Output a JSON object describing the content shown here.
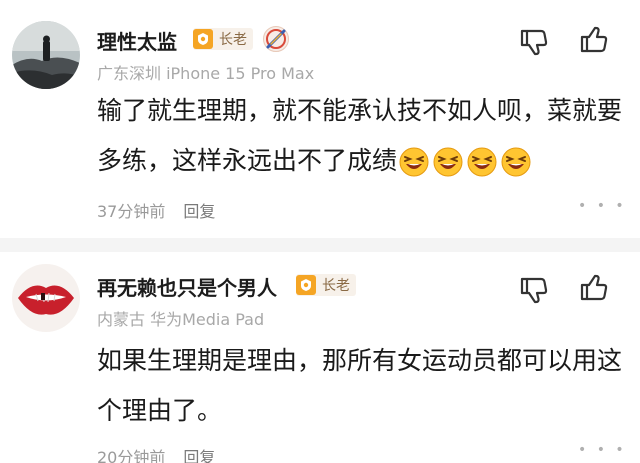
{
  "comments": [
    {
      "username": "理性太监",
      "badge": "长老",
      "location": "广东深圳 iPhone 15 Pro Max",
      "text": "输了就生理期，就不能承认技不如人呗，菜就要多练，这样永远出不了成绩",
      "emoji": [
        "laughing-emoji",
        "laughing-emoji",
        "laughing-emoji",
        "laughing-emoji"
      ],
      "time": "37分钟前",
      "reply_label": "回复",
      "more": "• • •"
    },
    {
      "username": "再无赖也只是个男人",
      "badge": "长老",
      "location": "内蒙古 华为Media Pad",
      "text": "如果生理期是理由，那所有女运动员都可以用这个理由了。",
      "time": "20分钟前",
      "reply_label": "回复",
      "more": "• • •"
    }
  ],
  "colors": {
    "badge_bg": "#f7f1ea",
    "badge_icon": "#f5a524",
    "badge_text": "#8a6a45",
    "separator": "#f4f4f4"
  },
  "icons": [
    "thumbs-down-icon",
    "thumbs-up-icon",
    "more-icon",
    "medal-icon"
  ]
}
